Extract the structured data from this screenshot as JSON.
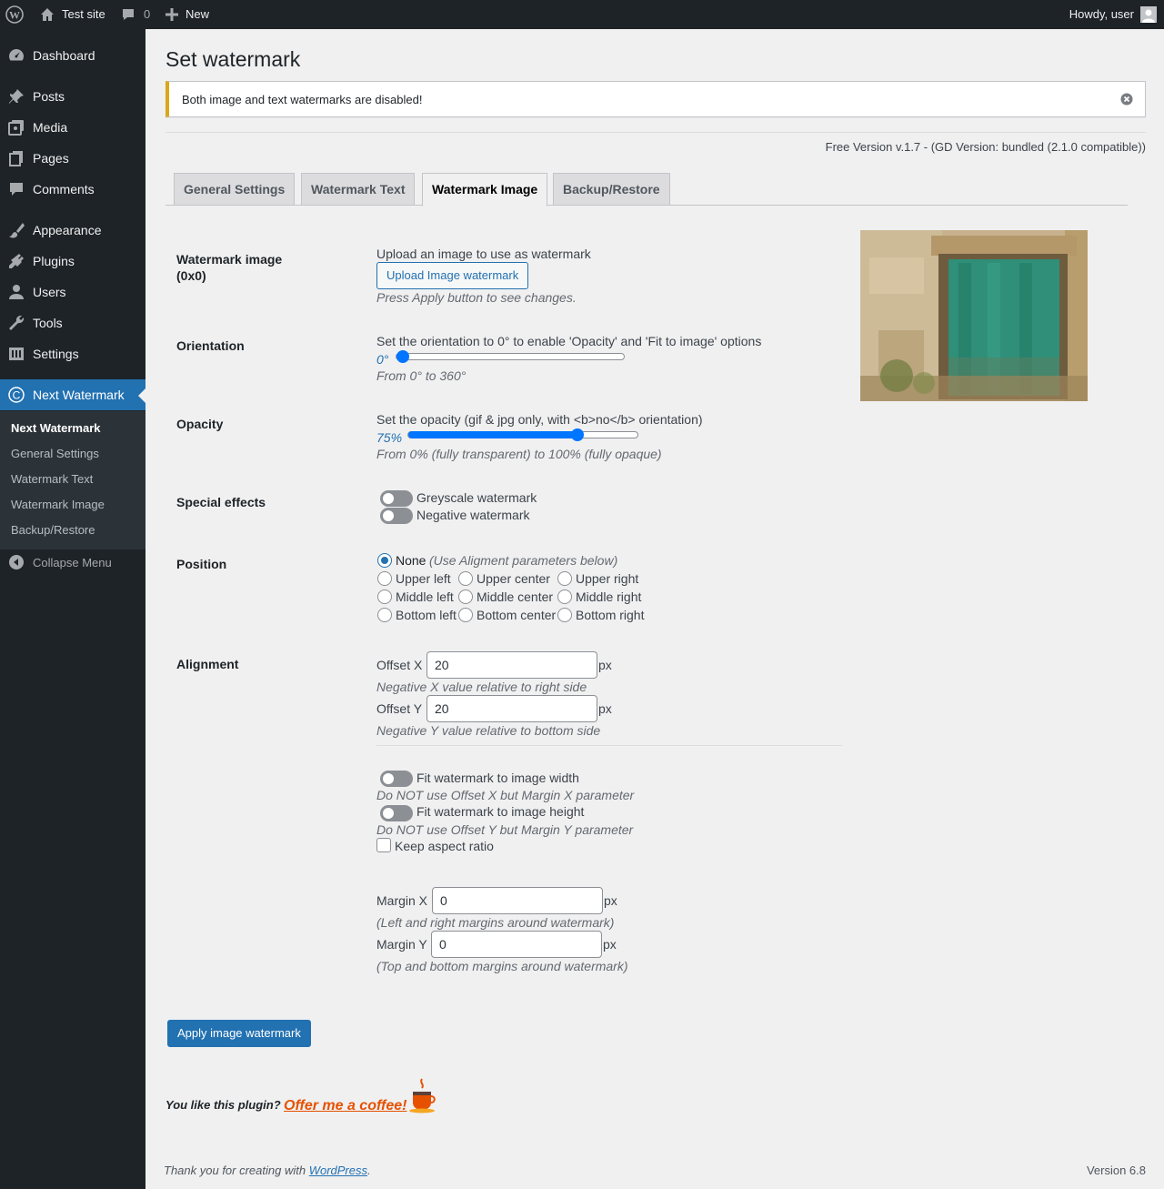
{
  "adminbar": {
    "site_name": "Test site",
    "comments_count": "0",
    "new_label": "New",
    "howdy": "Howdy, user"
  },
  "sidebar": {
    "items": [
      {
        "label": "Dashboard",
        "icon": "dashboard-icon"
      },
      {
        "label": "Posts",
        "icon": "pin-icon"
      },
      {
        "label": "Media",
        "icon": "media-icon"
      },
      {
        "label": "Pages",
        "icon": "pages-icon"
      },
      {
        "label": "Comments",
        "icon": "comment-icon"
      },
      {
        "label": "Appearance",
        "icon": "brush-icon"
      },
      {
        "label": "Plugins",
        "icon": "plug-icon"
      },
      {
        "label": "Users",
        "icon": "user-icon"
      },
      {
        "label": "Tools",
        "icon": "wrench-icon"
      },
      {
        "label": "Settings",
        "icon": "settings-icon"
      },
      {
        "label": "Next Watermark",
        "icon": "copyright-icon"
      }
    ],
    "submenu": [
      "Next Watermark",
      "General Settings",
      "Watermark Text",
      "Watermark Image",
      "Backup/Restore"
    ],
    "collapse": "Collapse Menu"
  },
  "page": {
    "title": "Set watermark",
    "notice": "Both image and text watermarks are disabled!",
    "version_info": "Free Version v.1.7 - (GD Version: bundled (2.1.0 compatible))",
    "tabs": [
      "General Settings",
      "Watermark Text",
      "Watermark Image",
      "Backup/Restore"
    ],
    "active_tab": "Watermark Image"
  },
  "form": {
    "watermark_image": {
      "label_line1": "Watermark image",
      "label_line2": "(0x0)",
      "intro": "Upload an image to use as watermark",
      "button": "Upload Image watermark",
      "hint": "Press Apply button to see changes."
    },
    "orientation": {
      "label": "Orientation",
      "intro": "Set the orientation to 0° to enable 'Opacity' and 'Fit to image' options",
      "value_text": "0°",
      "value": 0,
      "hint": "From 0° to 360°"
    },
    "opacity": {
      "label": "Opacity",
      "intro": "Set the opacity (gif & jpg only, with <b>no</b> orientation)",
      "value_text": "75%",
      "value": 75,
      "hint": "From 0% (fully transparent) to 100% (fully opaque)"
    },
    "special_effects": {
      "label": "Special effects",
      "greyscale": "Greyscale watermark",
      "negative": "Negative watermark"
    },
    "position": {
      "label": "Position",
      "none": "None",
      "none_hint": "(Use Aligment parameters below)",
      "options": [
        [
          "Upper left",
          "Upper center",
          "Upper right"
        ],
        [
          "Middle left",
          "Middle center",
          "Middle right"
        ],
        [
          "Bottom left",
          "Bottom center",
          "Bottom right"
        ]
      ],
      "selected": "None"
    },
    "alignment": {
      "label": "Alignment",
      "offset_x_label": "Offset X",
      "offset_x_value": "20",
      "offset_x_hint": "Negative X value relative to right side",
      "offset_y_label": "Offset Y",
      "offset_y_value": "20",
      "offset_y_hint": "Negative Y value relative to bottom side",
      "unit": "px",
      "fit_width": "Fit watermark to image width",
      "fit_width_hint": "Do NOT use Offset X but Margin X parameter",
      "fit_height": "Fit watermark to image height",
      "fit_height_hint": "Do NOT use Offset Y but Margin Y parameter",
      "keep_aspect": "Keep aspect ratio",
      "margin_x_label": "Margin X",
      "margin_x_value": "0",
      "margin_x_hint": "(Left and right margins around watermark)",
      "margin_y_label": "Margin Y",
      "margin_y_value": "0",
      "margin_y_hint": "(Top and bottom margins around watermark)"
    },
    "apply_button": "Apply image watermark"
  },
  "coffee": {
    "text": "You like this plugin?",
    "link": "Offer me a coffee!"
  },
  "footer": {
    "thanks_prefix": "Thank you for creating with ",
    "wordpress": "WordPress",
    "thanks_suffix": ".",
    "version": "Version 6.8"
  },
  "colors": {
    "accent": "#2271b1",
    "sidebar_bg": "#1d2327",
    "notice_border": "#dba617",
    "range_blue": "#0075ff",
    "coffee_orange": "#e65100"
  }
}
